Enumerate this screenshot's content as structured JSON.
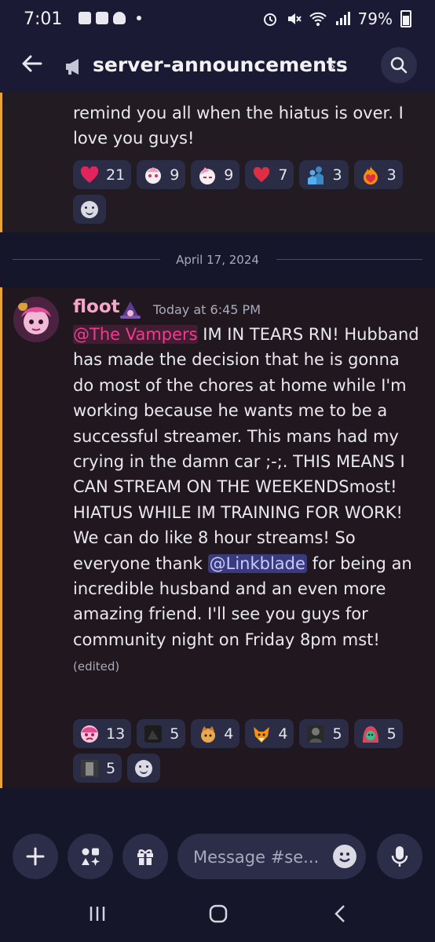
{
  "status": {
    "time": "7:01",
    "battery": "79%"
  },
  "header": {
    "channel": "server-announcements",
    "chevron": "›"
  },
  "message1": {
    "text": "remind you all when the hiatus is over. I love you guys!",
    "reactions": [
      {
        "icon": "red-heart",
        "count": "21"
      },
      {
        "icon": "anime-sticker-1",
        "count": "9"
      },
      {
        "icon": "anime-sticker-2",
        "count": "9"
      },
      {
        "icon": "small-heart",
        "count": "7"
      },
      {
        "icon": "hug-people",
        "count": "3"
      },
      {
        "icon": "heart-on-fire",
        "count": "3"
      }
    ]
  },
  "date_divider": "April 17, 2024",
  "message2": {
    "author": "floot",
    "timestamp": "Today at 6:45 PM",
    "mention1": "@The Vampers",
    "text1": " IM IN TEARS RN! Hubband has made the decision that he is gonna do most of the chores at home while I'm working because he wants me to be a successful streamer. This mans had my crying in the damn car ;-;. THIS MEANS I CAN STREAM ON THE WEEKENDSmost! HIATUS WHILE IM TRAINING FOR WORK! We can do like 8 hour streams! So everyone thank ",
    "mention2": "@Linkblade",
    "text2": " for being an incredible husband and an even more amazing friend.  I'll see you guys for community night on Friday 8pm mst!",
    "edited": "(edited)",
    "reactions": [
      {
        "icon": "pink-crying-emoji",
        "count": "13"
      },
      {
        "icon": "dark-sticker",
        "count": "5"
      },
      {
        "icon": "cat-dog",
        "count": "4"
      },
      {
        "icon": "fox-face",
        "count": "4"
      },
      {
        "icon": "dark-figure",
        "count": "5"
      },
      {
        "icon": "hooded-character",
        "count": "5"
      },
      {
        "icon": "grey-figure",
        "count": "5"
      }
    ]
  },
  "composer": {
    "placeholder": "Message #se..."
  },
  "colors": {
    "accent_bar": "#e8a531",
    "mention_pink": "#ee3d91",
    "mention_blue": "#5865f2"
  }
}
